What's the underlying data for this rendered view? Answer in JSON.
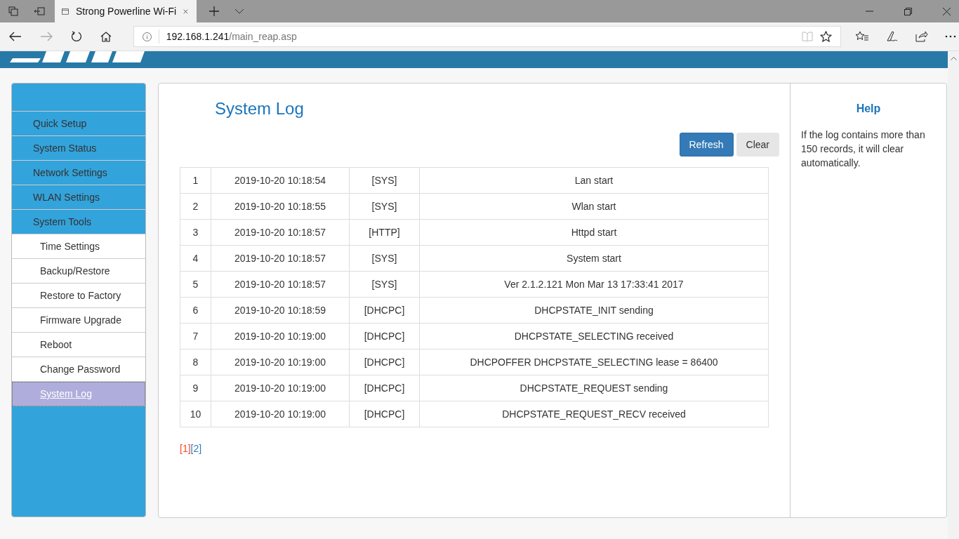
{
  "browser": {
    "tab_title": "Strong Powerline Wi-Fi",
    "address_host": "192.168.1.241",
    "address_path": "/main_reap.asp"
  },
  "sidebar": {
    "items": [
      {
        "label": "Quick Setup",
        "kind": "section",
        "selected": false
      },
      {
        "label": "System Status",
        "kind": "section",
        "selected": false
      },
      {
        "label": "Network Settings",
        "kind": "section",
        "selected": false
      },
      {
        "label": "WLAN Settings",
        "kind": "section",
        "selected": false
      },
      {
        "label": "System Tools",
        "kind": "section",
        "selected": false
      },
      {
        "label": "Time Settings",
        "kind": "sub",
        "selected": false
      },
      {
        "label": "Backup/Restore",
        "kind": "sub",
        "selected": false
      },
      {
        "label": "Restore to Factory",
        "kind": "sub",
        "selected": false
      },
      {
        "label": "Firmware Upgrade",
        "kind": "sub",
        "selected": false
      },
      {
        "label": "Reboot",
        "kind": "sub",
        "selected": false
      },
      {
        "label": "Change Password",
        "kind": "sub",
        "selected": false
      },
      {
        "label": "System Log",
        "kind": "sub",
        "selected": true
      }
    ]
  },
  "main": {
    "title": "System Log",
    "buttons": [
      {
        "label": "Refresh",
        "kind": "primary"
      },
      {
        "label": "Clear",
        "kind": "default"
      }
    ],
    "log_rows": [
      [
        "1",
        "2019-10-20 10:18:54",
        "[SYS]",
        "Lan start"
      ],
      [
        "2",
        "2019-10-20 10:18:55",
        "[SYS]",
        "Wlan start"
      ],
      [
        "3",
        "2019-10-20 10:18:57",
        "[HTTP]",
        "Httpd start"
      ],
      [
        "4",
        "2019-10-20 10:18:57",
        "[SYS]",
        "System start"
      ],
      [
        "5",
        "2019-10-20 10:18:57",
        "[SYS]",
        "Ver 2.1.2.121 Mon Mar 13 17:33:41 2017"
      ],
      [
        "6",
        "2019-10-20 10:18:59",
        "[DHCPC]",
        "DHCPSTATE_INIT sending"
      ],
      [
        "7",
        "2019-10-20 10:19:00",
        "[DHCPC]",
        "DHCPSTATE_SELECTING received"
      ],
      [
        "8",
        "2019-10-20 10:19:00",
        "[DHCPC]",
        "DHCPOFFER DHCPSTATE_SELECTING lease = 86400"
      ],
      [
        "9",
        "2019-10-20 10:19:00",
        "[DHCPC]",
        "DHCPSTATE_REQUEST sending"
      ],
      [
        "10",
        "2019-10-20 10:19:00",
        "[DHCPC]",
        "DHCPSTATE_REQUEST_RECV received"
      ]
    ],
    "pages": [
      {
        "label": "[1]",
        "selected": true
      },
      {
        "label": "[2]",
        "selected": false
      }
    ]
  },
  "help": {
    "title": "Help",
    "text": "If the log contains more than 150 records, it will clear automatically."
  }
}
